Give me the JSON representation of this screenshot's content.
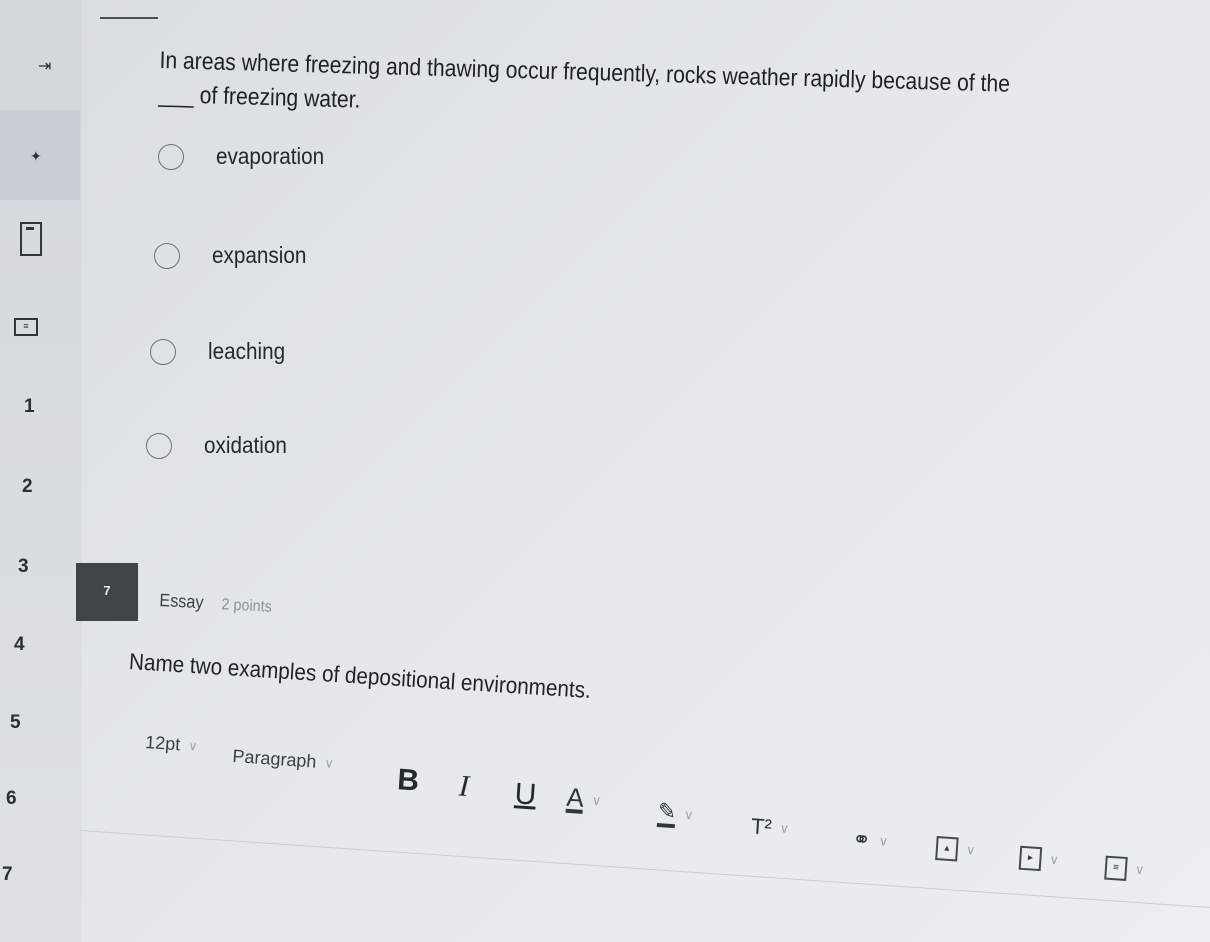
{
  "sidebar": {
    "question_numbers": [
      "1",
      "2",
      "3",
      "4",
      "5",
      "6",
      "7"
    ]
  },
  "question6": {
    "text": "In areas where freezing and thawing occur frequently, rocks weather rapidly because of the ___ of freezing water.",
    "options": [
      "evaporation",
      "expansion",
      "leaching",
      "oxidation"
    ]
  },
  "question7": {
    "number": "7",
    "type": "Essay",
    "points": "2 points",
    "text": "Name two examples of depositional environments."
  },
  "editor_toolbar": {
    "font_size": "12pt",
    "block_format": "Paragraph",
    "bold": "B",
    "italic": "I",
    "underline": "U",
    "text_color": "A",
    "superscript": "T²"
  },
  "colors": {
    "badge_bg": "#3f4448",
    "background": "#e3e7ea"
  }
}
